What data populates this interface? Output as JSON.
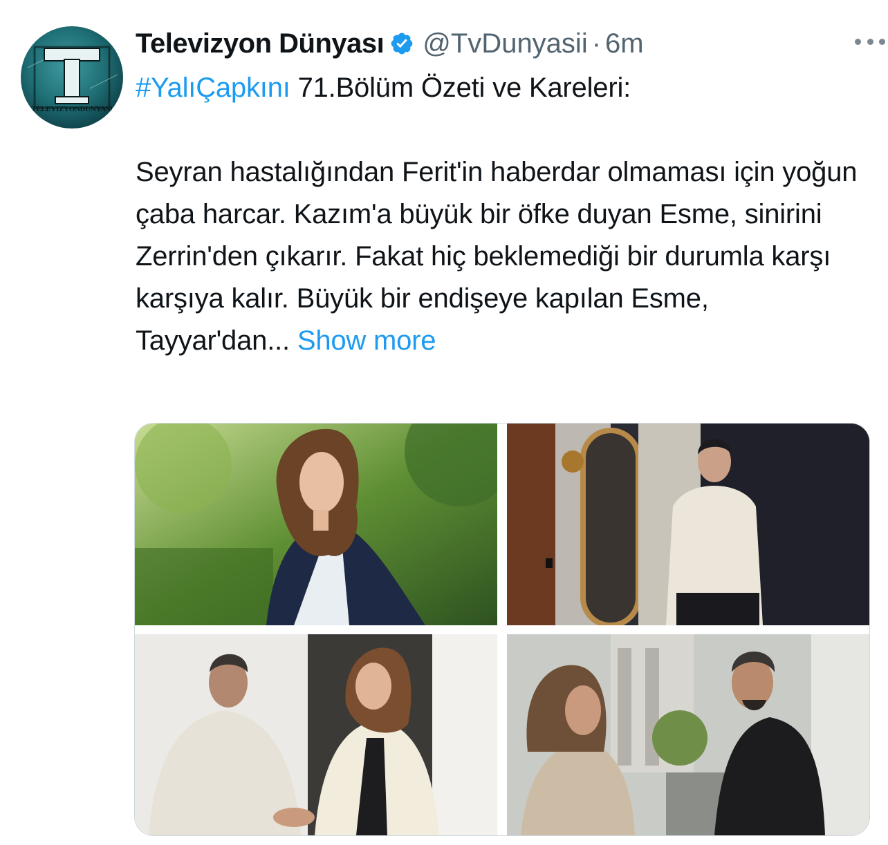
{
  "author": {
    "display_name": "Televizyon Dünyası",
    "handle": "@TvDunyasii",
    "separator": "·",
    "time": "6m",
    "avatar_caption": "TELEVIZYONDUNYASI",
    "avatar_letter": "T",
    "verified_icon": "verified-badge-icon"
  },
  "tweet": {
    "hashtag": "#YalıÇapkını",
    "headline": " 71.Bölüm Özeti ve Kareleri:",
    "body": "Seyran hastalığından Ferit'in haberdar olmaması için yoğun çaba harcar. Kazım'a büyük bir öfke duyan Esme, sinirini Zerrin'den çıkarır. Fakat hiç beklemediği bir durumla karşı karşıya kalır. Büyük bir endişeye kapılan Esme, Tayyar'dan... ",
    "show_more": "Show more"
  },
  "media": {
    "count": 4,
    "photos": [
      {
        "name": "photo-woman-blazer-garden"
      },
      {
        "name": "photo-man-white-sweater-mirror"
      },
      {
        "name": "photo-handshake-woman-cream-blazer"
      },
      {
        "name": "photo-woman-man-courtyard"
      }
    ]
  },
  "colors": {
    "link": "#1d9bf0",
    "text": "#0f1419",
    "secondary": "#536471",
    "border": "#cfd9de"
  },
  "icons": {
    "more": "more-options-icon",
    "verified": "verified-badge-icon"
  }
}
